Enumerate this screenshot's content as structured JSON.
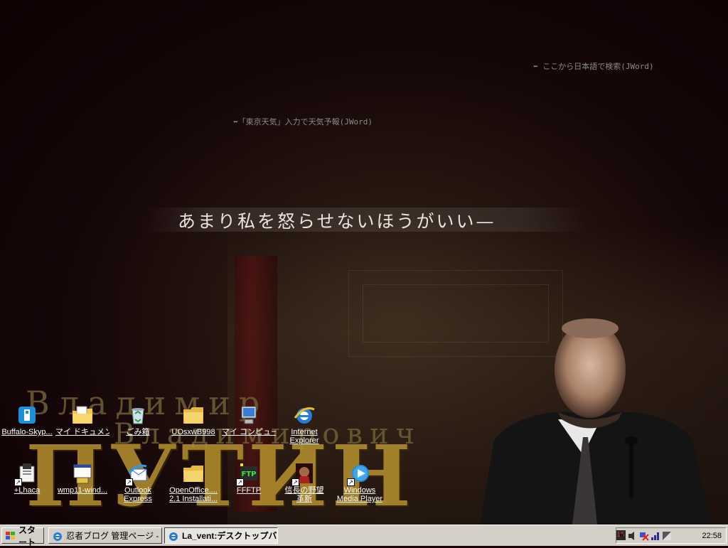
{
  "desktop": {
    "hint_search": "ここから日本語で検索(JWord)",
    "hint_weather": "「東京天気」入力で天気予報(JWord)",
    "quote": "あまり私を怒らせないほうがいい—",
    "wallpaper_name_line1": "Владимир",
    "wallpaper_name_line2": "Владимирович",
    "wallpaper_name_line3": "ПУТИН"
  },
  "icons": [
    {
      "label": "Buffalo-Skyp...",
      "icon": "buffalo-skype-icon"
    },
    {
      "label": "マイ ドキュメント",
      "icon": "my-documents-icon"
    },
    {
      "label": "ごみ箱",
      "icon": "recycle-bin-icon"
    },
    {
      "label": "UOsxwB998",
      "icon": "folder-icon"
    },
    {
      "label": "マイ コンピュータ",
      "icon": "my-computer-icon"
    },
    {
      "label": "Internet Explorer",
      "label2": "Explorer",
      "label1": "Internet",
      "icon": "internet-explorer-icon"
    },
    {
      "label": "+Lhaca",
      "icon": "lhaca-icon"
    },
    {
      "label": "wmp11-wind...",
      "icon": "installer-icon"
    },
    {
      "label1": "Outlook",
      "label2": "Express",
      "icon": "outlook-express-icon"
    },
    {
      "label1": "OpenOffice....",
      "label2": "2.1 Installati...",
      "icon": "folder-icon"
    },
    {
      "label": "FFFTP",
      "icon": "ffftp-icon"
    },
    {
      "label1": "信長の野望",
      "label2": "革新",
      "icon": "nobunaga-game-icon"
    },
    {
      "label1": "Windows",
      "label2": "Media Player",
      "icon": "windows-media-player-icon"
    }
  ],
  "taskbar": {
    "start_label": "スタート",
    "tasks": [
      {
        "label": "忍者ブログ 管理ページ - ...",
        "active": false
      },
      {
        "label": "La_vent:デスクトップバ...",
        "active": true
      }
    ],
    "tray_chevron": "«",
    "clock": "22:58"
  },
  "colors": {
    "desktop_bg": "#1a0406",
    "taskbar_bg": "#d4d0c8",
    "name_gold": "#b8922e"
  }
}
